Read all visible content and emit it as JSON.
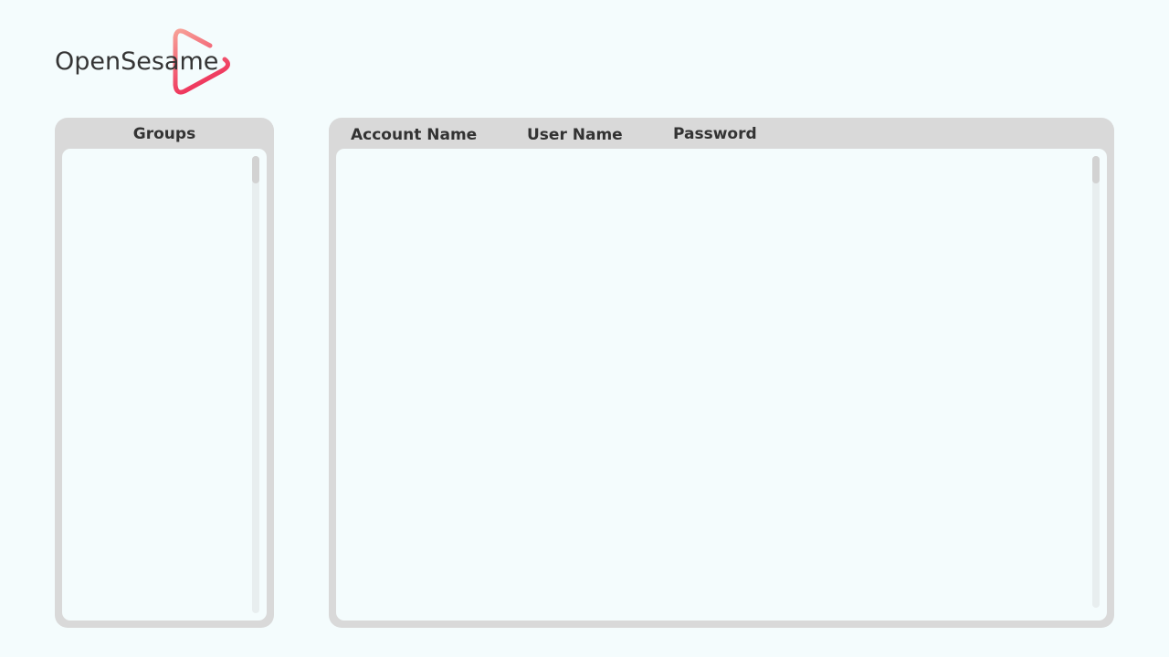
{
  "app": {
    "logo_text": "OpenSesame",
    "brand_gradient": [
      "#f7a097",
      "#ee2f59"
    ]
  },
  "groups": {
    "title": "Groups",
    "items": []
  },
  "accounts": {
    "columns": {
      "account_name": "Account Name",
      "user_name": "User Name",
      "password": "Password"
    },
    "rows": []
  },
  "colors": {
    "background": "#f4fcfd",
    "panel": "#d9d9d9",
    "scroll_track": "#e8eeef",
    "scroll_thumb": "#d2d2d2",
    "text": "#333333"
  }
}
